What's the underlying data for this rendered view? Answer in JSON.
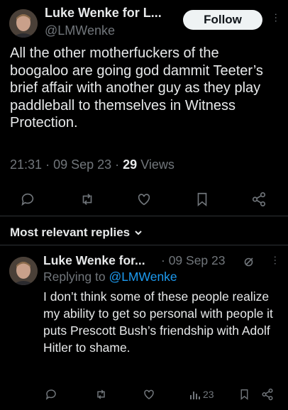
{
  "tweet": {
    "author_name": "Luke Wenke for L...",
    "author_handle": "@LMWenke",
    "follow_label": "Follow",
    "text": "All the other motherfuckers of the boogaloo are going god dammit Teeter’s brief affair with another guy as they play paddleball to themselves in Witness Protection.",
    "time": "21:31",
    "date": "09 Sep 23",
    "views_count": "29",
    "views_label": "Views"
  },
  "replies_header": {
    "label": "Most relevant replies"
  },
  "reply": {
    "author_name": "Luke Wenke for...",
    "date": "09 Sep 23",
    "replying_prefix": "Replying to",
    "replying_handle": "@LMWenke",
    "text": "I don’t think some of these people realize my ability to get so personal with people it puts Prescott Bush’s friendship with Adolf Hitler to shame.",
    "views_count": "23"
  },
  "colors": {
    "background": "#000000",
    "primary_text": "#e7e9ea",
    "secondary_text": "#71767b",
    "link": "#1d9bf0",
    "divider": "#2f3336"
  }
}
